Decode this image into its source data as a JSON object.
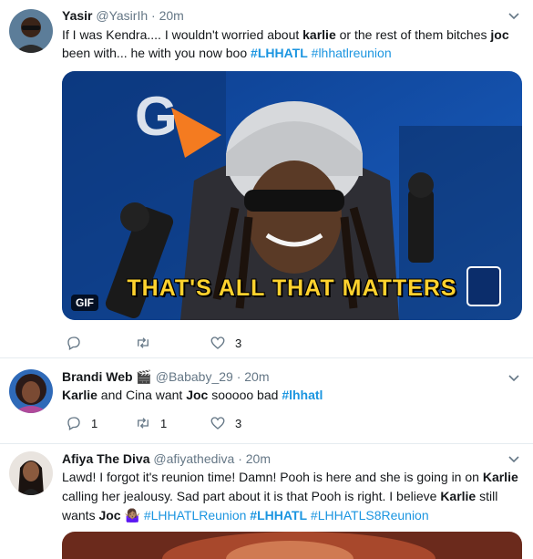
{
  "tweets": [
    {
      "name": "Yasir",
      "handle": "@YasirIh",
      "sep": "·",
      "time": "20m",
      "text_parts": [
        "If I was Kendra.... I wouldn't worried about ",
        "karlie",
        " or the rest of them bitches ",
        "joc",
        " been with... he with you now boo "
      ],
      "hashtags": [
        "#LHHATL",
        "#lhhatlreunion"
      ],
      "media": {
        "badge": "GIF",
        "caption": "THAT'S ALL THAT MATTERS",
        "logo_letter": "G"
      },
      "actions": {
        "reply_count": "",
        "retweet_count": "",
        "like_count": "3"
      }
    },
    {
      "name": "Brandi Web",
      "name_emoji": "🎬",
      "handle": "@Bababy_29",
      "sep": "·",
      "time": "20m",
      "text_parts": [
        "Karlie",
        " and Cina want ",
        "Joc",
        " sooooo bad  "
      ],
      "hashtags": [
        "#lhhatl"
      ],
      "actions": {
        "reply_count": "1",
        "retweet_count": "1",
        "like_count": "3"
      }
    },
    {
      "name": "Afiya The Diva",
      "handle": "@afiyathediva",
      "sep": "·",
      "time": "20m",
      "text_line1": "Lawd! I forgot it's reunion time! Damn! Pooh is here and she is going in on ",
      "text_b1": "Karlie",
      "text_line2": " calling her jealousy. Sad part about it is that Pooh is right. I believe ",
      "text_b2": "Karlie",
      "text_line3": " still wants ",
      "text_b3": "Joc",
      "emoji": "🤷🏽‍♀️",
      "hashtags": [
        "#LHHATLReunion",
        "#LHHATL",
        "#LHHATLS8Reunion"
      ]
    }
  ],
  "colors": {
    "link": "#1b95e0",
    "muted": "#657786",
    "divider": "#e6ecf0",
    "caption": "#ffd22e"
  },
  "icons": [
    "reply-icon",
    "retweet-icon",
    "like-icon",
    "chevron-down-icon"
  ]
}
